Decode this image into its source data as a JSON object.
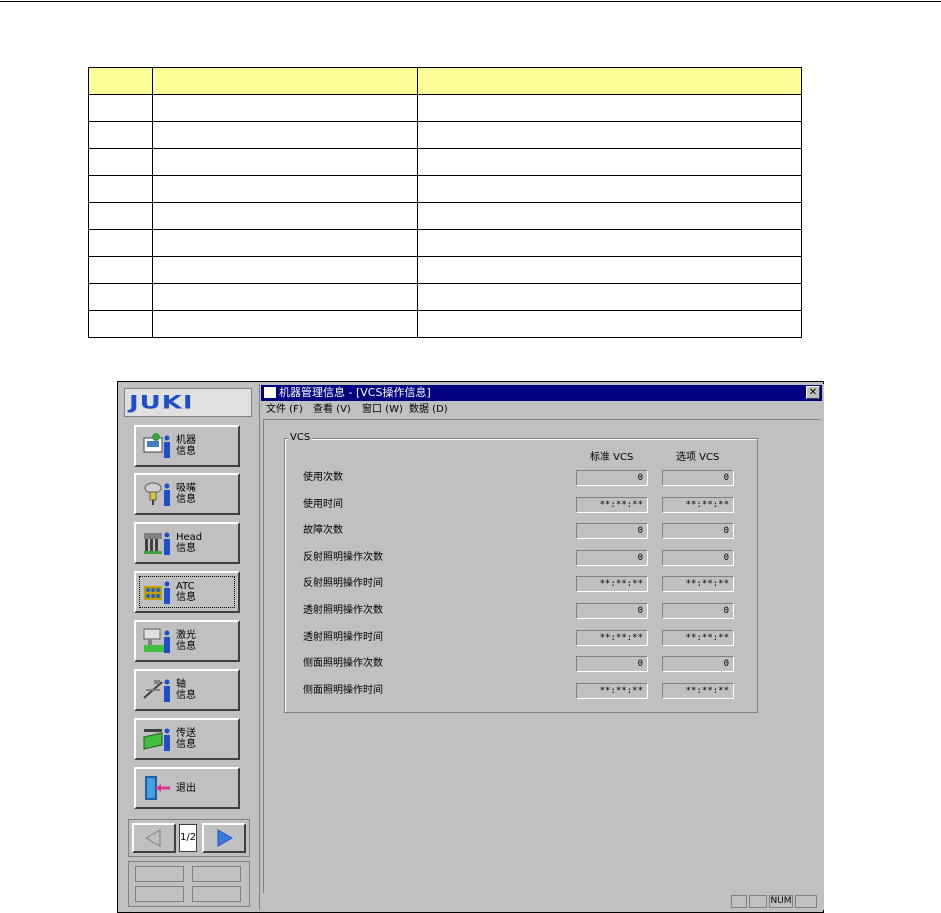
{
  "window": {
    "title": "机器管理信息 - [VCS操作信息]",
    "close_label": "✕"
  },
  "menu": [
    {
      "label": "文件 (F)"
    },
    {
      "label": "查看 (V)"
    },
    {
      "label": "窗口 (W)"
    },
    {
      "label": "数据 (D)"
    }
  ],
  "logo": "JUKI",
  "sidebar": {
    "buttons": [
      {
        "label_line1": "机器",
        "label_line2": "信息",
        "icon": "machine-icon"
      },
      {
        "label_line1": "吸嘴",
        "label_line2": "信息",
        "icon": "nozzle-icon"
      },
      {
        "label_line1": "Head",
        "label_line2": "信息",
        "icon": "head-icon"
      },
      {
        "label_line1": "ATC",
        "label_line2": "信息",
        "icon": "atc-icon"
      },
      {
        "label_line1": "激光",
        "label_line2": "信息",
        "icon": "laser-icon"
      },
      {
        "label_line1": "轴",
        "label_line2": "信息",
        "icon": "axis-icon"
      },
      {
        "label_line1": "传送",
        "label_line2": "信息",
        "icon": "conveyor-icon"
      },
      {
        "label_line1": "退出",
        "label_line2": "",
        "icon": "exit-icon"
      }
    ],
    "page_indicator": "1/2"
  },
  "vcs": {
    "group_title": "VCS",
    "col_standard": "标准 VCS",
    "col_option": "选项 VCS",
    "rows": [
      {
        "label": "使用次数",
        "standard": "0",
        "option": "0"
      },
      {
        "label": "使用时间",
        "standard": "**:**:**",
        "option": "**:**:**"
      },
      {
        "label": "故障次数",
        "standard": "0",
        "option": "0"
      },
      {
        "label": "反射照明操作次数",
        "standard": "0",
        "option": "0"
      },
      {
        "label": "反射照明操作时间",
        "standard": "**:**:**",
        "option": "**:**:**"
      },
      {
        "label": "透射照明操作次数",
        "standard": "0",
        "option": "0"
      },
      {
        "label": "透射照明操作时间",
        "standard": "**:**:**",
        "option": "**:**:**"
      },
      {
        "label": "侧面照明操作次数",
        "standard": "0",
        "option": "0"
      },
      {
        "label": "侧面照明操作时间",
        "standard": "**:**:**",
        "option": "**:**:**"
      }
    ]
  },
  "statusbar": {
    "num": "NUM"
  },
  "colors": {
    "titlebar": "#000080",
    "logo": "#1f4fc8",
    "table_header": "#ffff99"
  }
}
